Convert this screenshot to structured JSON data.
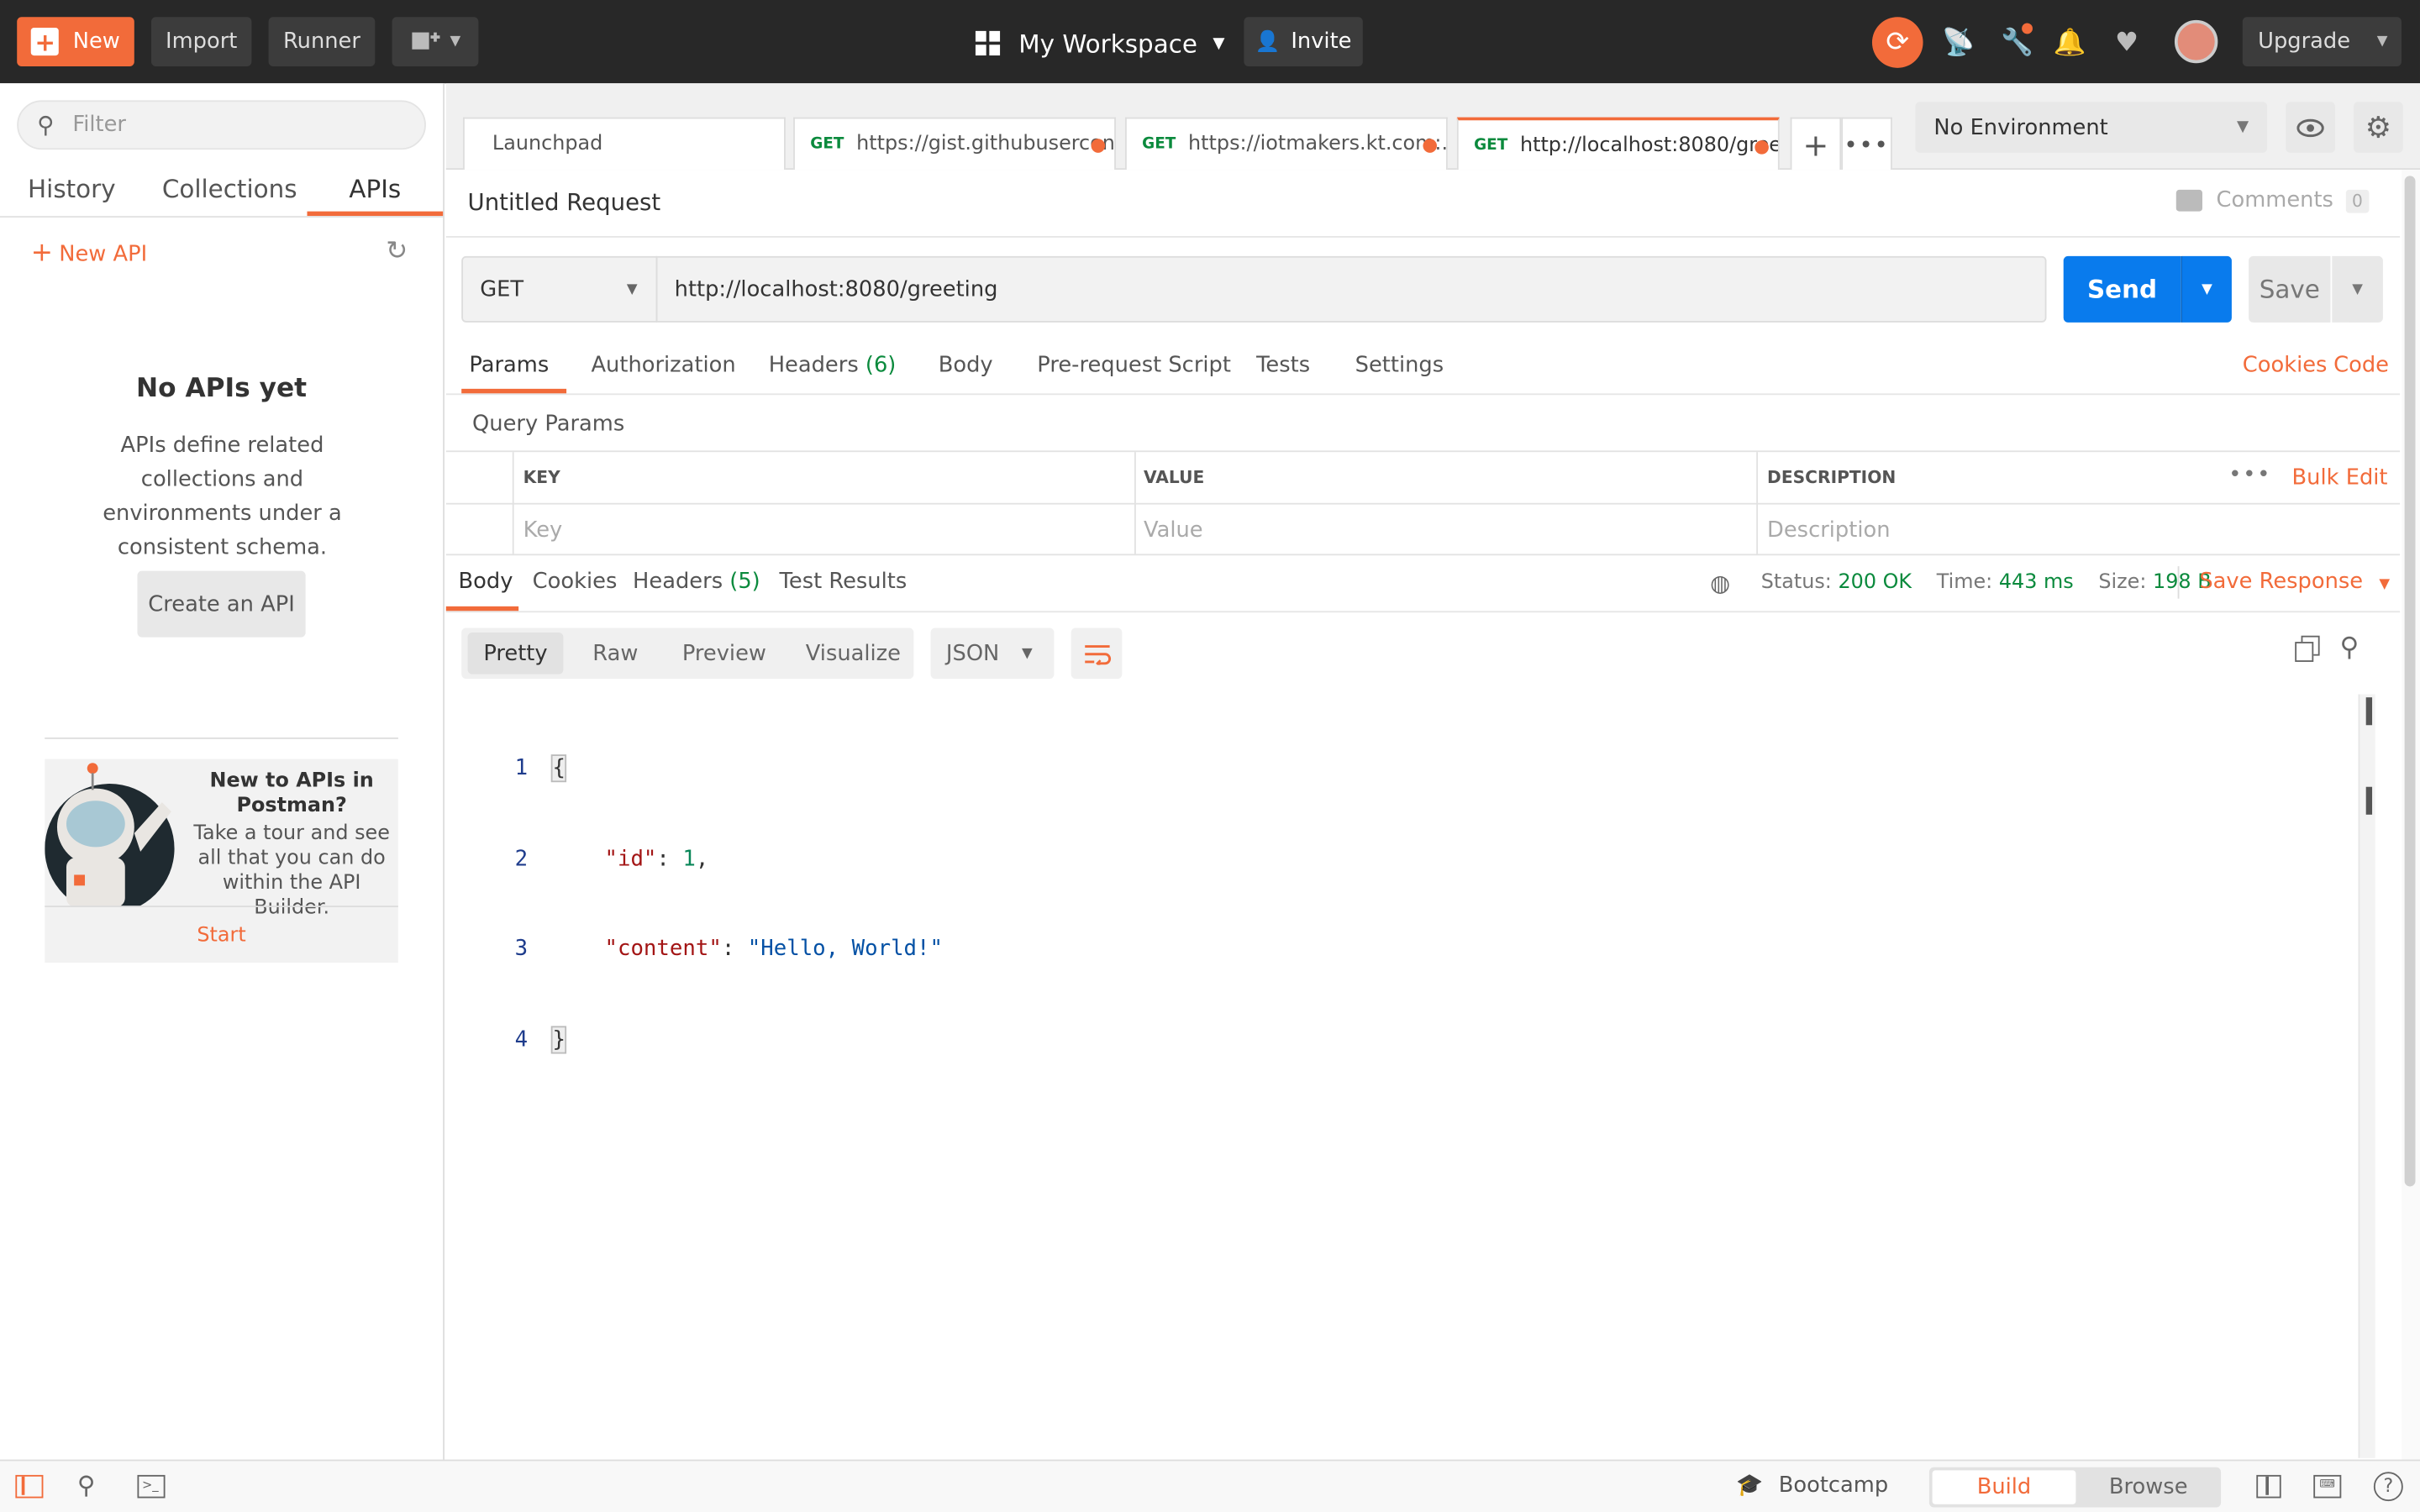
{
  "topbar": {
    "new_label": "New",
    "import_label": "Import",
    "runner_label": "Runner",
    "workspace_label": "My Workspace",
    "invite_label": "Invite",
    "upgrade_label": "Upgrade"
  },
  "sidebar": {
    "filter_placeholder": "Filter",
    "tabs": [
      "History",
      "Collections",
      "APIs"
    ],
    "new_api_label": "New API",
    "empty_title": "No APIs yet",
    "empty_desc": "APIs define related collections and environments under a consistent schema.",
    "create_label": "Create an API",
    "promo_title": "New to APIs in Postman?",
    "promo_text": "Take a tour and see all that you can do within the API Builder.",
    "start_label": "Start"
  },
  "tabs": [
    {
      "method": "",
      "label": "Launchpad",
      "dirty": false
    },
    {
      "method": "GET",
      "label": "https://gist.githubusercon...",
      "dirty": true
    },
    {
      "method": "GET",
      "label": "https://iotmakers.kt.com:...",
      "dirty": true
    },
    {
      "method": "GET",
      "label": "http://localhost:8080/gree...",
      "dirty": true
    }
  ],
  "environment": {
    "label": "No Environment"
  },
  "request": {
    "title": "Untitled Request",
    "comments_label": "Comments",
    "comments_count": "0",
    "method": "GET",
    "url": "http://localhost:8080/greeting",
    "send_label": "Send",
    "save_label": "Save",
    "tabs": {
      "params": "Params",
      "authorization": "Authorization",
      "headers": "Headers",
      "headers_count": "(6)",
      "body": "Body",
      "prerequest": "Pre-request Script",
      "tests": "Tests",
      "settings": "Settings"
    },
    "cookies_label": "Cookies",
    "code_label": "Code",
    "query_params_label": "Query Params",
    "table": {
      "col_key": "KEY",
      "col_value": "VALUE",
      "col_desc": "DESCRIPTION",
      "bulk_edit": "Bulk Edit",
      "ph_key": "Key",
      "ph_value": "Value",
      "ph_desc": "Description"
    }
  },
  "response": {
    "tabs": {
      "body": "Body",
      "cookies": "Cookies",
      "headers": "Headers",
      "headers_count": "(5)",
      "test_results": "Test Results"
    },
    "status_label": "Status:",
    "status_value": "200 OK",
    "time_label": "Time:",
    "time_value": "443 ms",
    "size_label": "Size:",
    "size_value": "198 B",
    "save_response_label": "Save Response",
    "view_modes": [
      "Pretty",
      "Raw",
      "Preview",
      "Visualize"
    ],
    "format": "JSON",
    "line_numbers": [
      "1",
      "2",
      "3",
      "4"
    ],
    "json": {
      "open_brace": "{",
      "key_id": "\"id\"",
      "val_id": "1",
      "key_content": "\"content\"",
      "val_content": "\"Hello, World!\"",
      "close_brace": "}"
    }
  },
  "statusbar": {
    "bootcamp_label": "Bootcamp",
    "build_label": "Build",
    "browse_label": "Browse"
  }
}
